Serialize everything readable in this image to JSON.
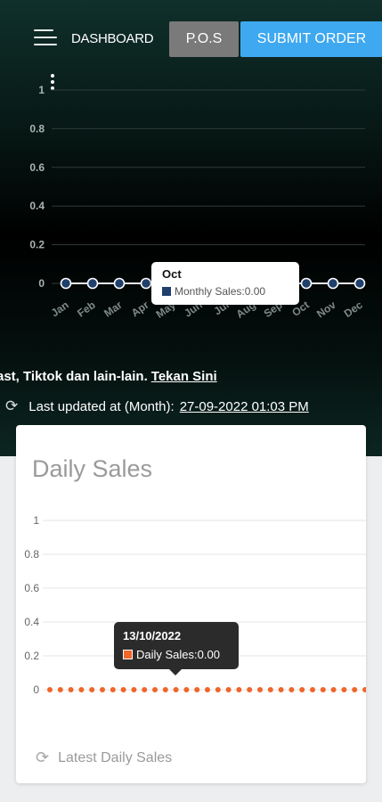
{
  "header": {
    "dashboard_label": "DASHBOARD",
    "pos_label": "P.O.S",
    "submit_label": "SUBMIT ORDER",
    "pos_color": "#7a7a7a",
    "submit_color": "#3ea8f0"
  },
  "monthly_chart": {
    "y_ticks": [
      "1",
      "0.8",
      "0.6",
      "0.4",
      "0.2",
      "0"
    ],
    "tooltip": {
      "title": "Oct",
      "series_label": "Monthly Sales:",
      "value": "0.00"
    },
    "series_color": "#1f3f6c"
  },
  "info": {
    "text": "ast, Tiktok dan lain-lain.",
    "link": "Tekan Sini",
    "updated_label": "Last updated at (Month):",
    "updated_value": "27-09-2022 01:03 PM"
  },
  "daily_card": {
    "title": "Daily Sales",
    "y_ticks": [
      "1",
      "0.8",
      "0.6",
      "0.4",
      "0.2",
      "0"
    ],
    "tooltip": {
      "title": "13/10/2022",
      "series_label": "Daily Sales:",
      "value": "0.00"
    },
    "footer": "Latest Daily Sales",
    "series_color": "#f0652a"
  },
  "chart_data": [
    {
      "type": "line",
      "categories": [
        "Jan",
        "Feb",
        "Mar",
        "Apr",
        "May",
        "Jun",
        "Jul",
        "Aug",
        "Sep",
        "Oct",
        "Nov",
        "Dec"
      ],
      "series": [
        {
          "name": "Monthly Sales",
          "values": [
            0,
            0,
            0,
            0,
            0,
            0,
            0,
            0,
            0,
            0,
            0,
            0
          ]
        }
      ],
      "ylim": [
        0,
        1
      ]
    },
    {
      "type": "line",
      "point_count": 31,
      "series": [
        {
          "name": "Daily Sales",
          "values": [
            0,
            0,
            0,
            0,
            0,
            0,
            0,
            0,
            0,
            0,
            0,
            0,
            0,
            0,
            0,
            0,
            0,
            0,
            0,
            0,
            0,
            0,
            0,
            0,
            0,
            0,
            0,
            0,
            0,
            0,
            0
          ]
        }
      ],
      "ylim": [
        0,
        1
      ]
    }
  ]
}
